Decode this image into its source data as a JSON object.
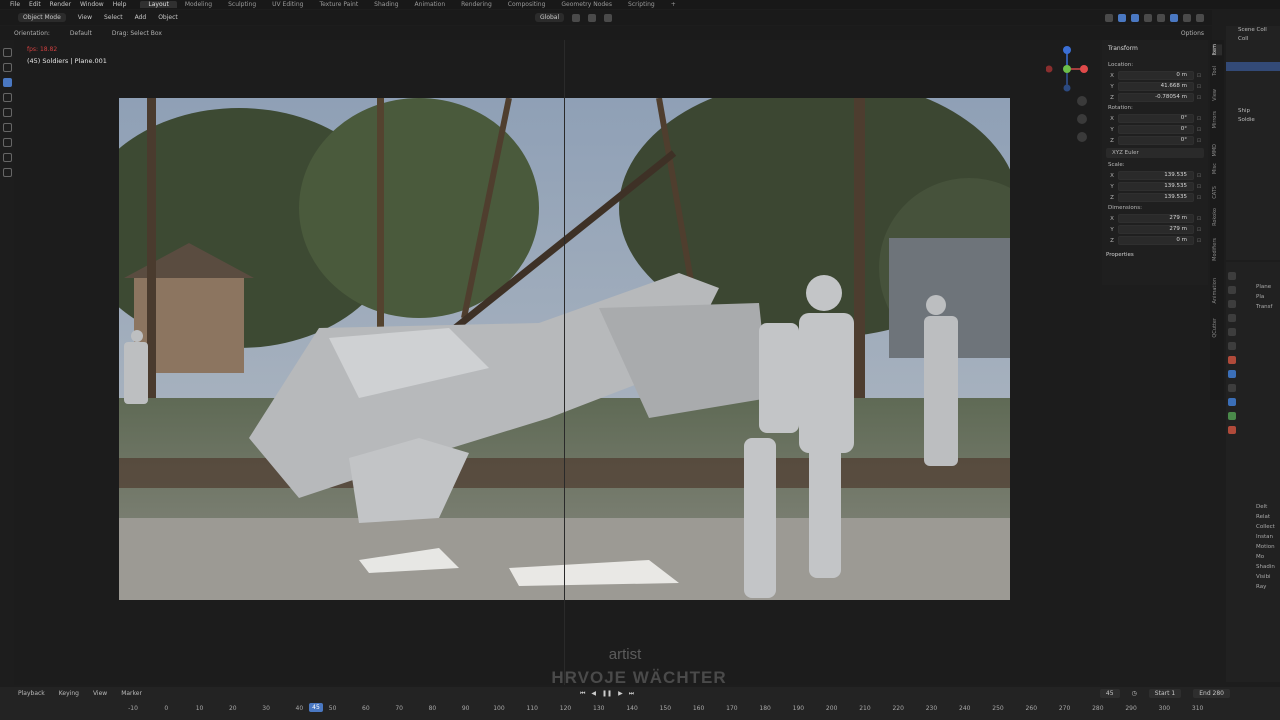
{
  "menu": [
    "File",
    "Edit",
    "Render",
    "Window",
    "Help"
  ],
  "workspaces": [
    "Layout",
    "Modeling",
    "Sculpting",
    "UV Editing",
    "Texture Paint",
    "Shading",
    "Animation",
    "Rendering",
    "Compositing",
    "Geometry Nodes",
    "Scripting",
    "+"
  ],
  "active_workspace": "Layout",
  "viewport_header": {
    "mode": "Object Mode",
    "items": [
      "View",
      "Select",
      "Add",
      "Object"
    ],
    "transform_orientation": "Global",
    "options": "Options"
  },
  "tool_header": {
    "orientation_label": "Orientation:",
    "orientation_value": "Default",
    "drag_label": "Drag:",
    "drag_value": "Select Box"
  },
  "viewport": {
    "fps": "fps: 18.82",
    "object_info": "(45) Soldiers | Plane.001"
  },
  "credit": {
    "role": "artist",
    "name": "HRVOJE WÄCHTER"
  },
  "npanel": {
    "title": "Transform",
    "location_label": "Location:",
    "location": [
      {
        "ax": "X",
        "v": "0 m"
      },
      {
        "ax": "Y",
        "v": "41.668 m"
      },
      {
        "ax": "Z",
        "v": "-0.78054 m"
      }
    ],
    "rotation_label": "Rotation:",
    "rotation": [
      {
        "ax": "X",
        "v": "0°"
      },
      {
        "ax": "Y",
        "v": "0°"
      },
      {
        "ax": "Z",
        "v": "0°"
      }
    ],
    "rotation_mode": "XYZ Euler",
    "scale_label": "Scale:",
    "scale": [
      {
        "ax": "X",
        "v": "139.535"
      },
      {
        "ax": "Y",
        "v": "139.535"
      },
      {
        "ax": "Z",
        "v": "139.535"
      }
    ],
    "dimensions_label": "Dimensions:",
    "dimensions": [
      {
        "ax": "X",
        "v": "279 m"
      },
      {
        "ax": "Y",
        "v": "279 m"
      },
      {
        "ax": "Z",
        "v": "0 m"
      }
    ],
    "properties_label": "Properties"
  },
  "side_tabs": [
    "Item",
    "Tool",
    "View",
    "Mirrors",
    "MMD",
    "Misc",
    "CATS",
    "Rokoko",
    "Modifiers",
    "Animation",
    "QCutter"
  ],
  "outliner": [
    "Scene Coll",
    "Coll",
    "",
    "",
    "",
    "",
    "",
    "",
    "",
    "Ship",
    "Soldie"
  ],
  "properties": {
    "items": [
      "Plane",
      "Pla",
      "Transf"
    ],
    "lower": [
      "Delt",
      "Relat",
      "Collect",
      "Instan",
      "Motion",
      "Mo",
      "Shadin",
      "Visibi",
      "Ray"
    ]
  },
  "timeline": {
    "menus": [
      "Playback",
      "Keying",
      "View",
      "Marker"
    ],
    "current_frame": "45",
    "start_label": "Start",
    "start": "1",
    "end_label": "End",
    "end": "280",
    "ticks": [
      "-10",
      "0",
      "10",
      "20",
      "30",
      "40",
      "50",
      "60",
      "70",
      "80",
      "90",
      "100",
      "110",
      "120",
      "130",
      "140",
      "150",
      "160",
      "170",
      "180",
      "190",
      "200",
      "210",
      "220",
      "230",
      "240",
      "250",
      "260",
      "270",
      "280",
      "290",
      "300",
      "310"
    ]
  }
}
